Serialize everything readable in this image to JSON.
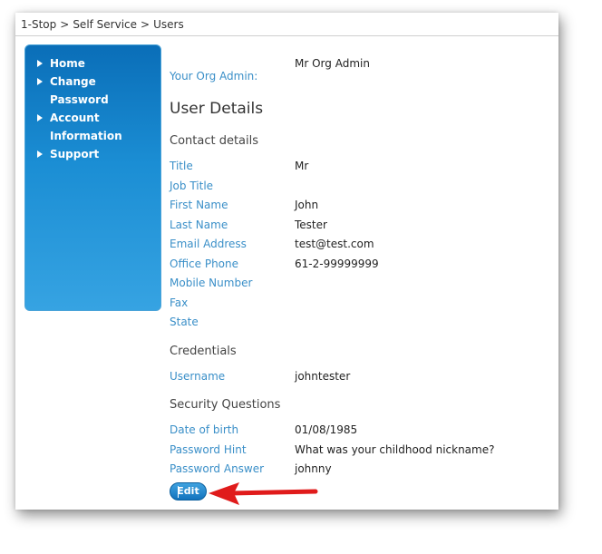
{
  "breadcrumb": {
    "items": [
      "1-Stop",
      "Self Service",
      "Users"
    ],
    "separator": ">"
  },
  "sidebar": {
    "items": [
      {
        "line1": "Home",
        "line2": ""
      },
      {
        "line1": "Change",
        "line2": "Password"
      },
      {
        "line1": "Account",
        "line2": "Information"
      },
      {
        "line1": "Support",
        "line2": ""
      }
    ]
  },
  "org_admin": {
    "label": "Your Org Admin:",
    "value": "Mr Org Admin"
  },
  "page_title": "User Details",
  "contact": {
    "heading": "Contact details",
    "fields": [
      {
        "label": "Title",
        "value": "Mr"
      },
      {
        "label": "Job Title",
        "value": ""
      },
      {
        "label": "First Name",
        "value": "John"
      },
      {
        "label": "Last Name",
        "value": "Tester"
      },
      {
        "label": "Email Address",
        "value": "test@test.com"
      },
      {
        "label": "Office Phone",
        "value": "61-2-99999999"
      },
      {
        "label": "Mobile Number",
        "value": ""
      },
      {
        "label": "Fax",
        "value": ""
      },
      {
        "label": "State",
        "value": ""
      }
    ]
  },
  "credentials": {
    "heading": "Credentials",
    "fields": [
      {
        "label": "Username",
        "value": "johntester"
      }
    ]
  },
  "security": {
    "heading": "Security Questions",
    "fields": [
      {
        "label": "Date of birth",
        "value": "01/08/1985"
      },
      {
        "label": "Password Hint",
        "value": "What was your childhood nickname?"
      },
      {
        "label": "Password Answer",
        "value": "johnny"
      }
    ]
  },
  "edit_button": {
    "label": "Edit"
  },
  "colors": {
    "label_blue": "#3a8fc8",
    "sidebar_blue": "#1b8ed4",
    "arrow_red": "#e01b1b"
  }
}
